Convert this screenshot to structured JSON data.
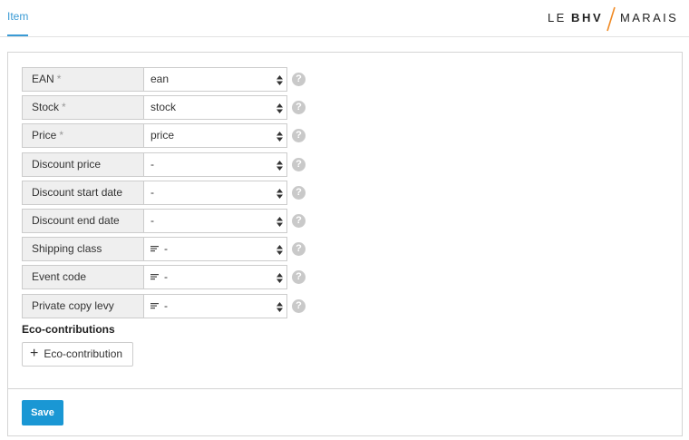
{
  "tabs": [
    {
      "label": "Item"
    }
  ],
  "logo": {
    "le": "LE",
    "bhv": "BHV",
    "marais": "MARAIS",
    "accent": "#f08a24"
  },
  "form": {
    "fields": [
      {
        "label": "EAN",
        "required": "*",
        "value": "ean",
        "has_lines_icon": false
      },
      {
        "label": "Stock",
        "required": "*",
        "value": "stock",
        "has_lines_icon": false
      },
      {
        "label": "Price",
        "required": "*",
        "value": "price",
        "has_lines_icon": false
      },
      {
        "label": "Discount price",
        "required": "",
        "value": "-",
        "has_lines_icon": false
      },
      {
        "label": "Discount start date",
        "required": "",
        "value": "-",
        "has_lines_icon": false
      },
      {
        "label": "Discount end date",
        "required": "",
        "value": "-",
        "has_lines_icon": false
      },
      {
        "label": "Shipping class",
        "required": "",
        "value": "-",
        "has_lines_icon": true
      },
      {
        "label": "Event code",
        "required": "",
        "value": "-",
        "has_lines_icon": true
      },
      {
        "label": "Private copy levy",
        "required": "",
        "value": "-",
        "has_lines_icon": true
      }
    ],
    "help_glyph": "?"
  },
  "eco": {
    "title": "Eco-contributions",
    "add_label": "Eco-contribution",
    "plus_glyph": "+"
  },
  "actions": {
    "save_label": "Save"
  },
  "colors": {
    "primary": "#1a97d4",
    "tab_active": "#3a9bd5",
    "help_icon": "#c9c9c9"
  }
}
